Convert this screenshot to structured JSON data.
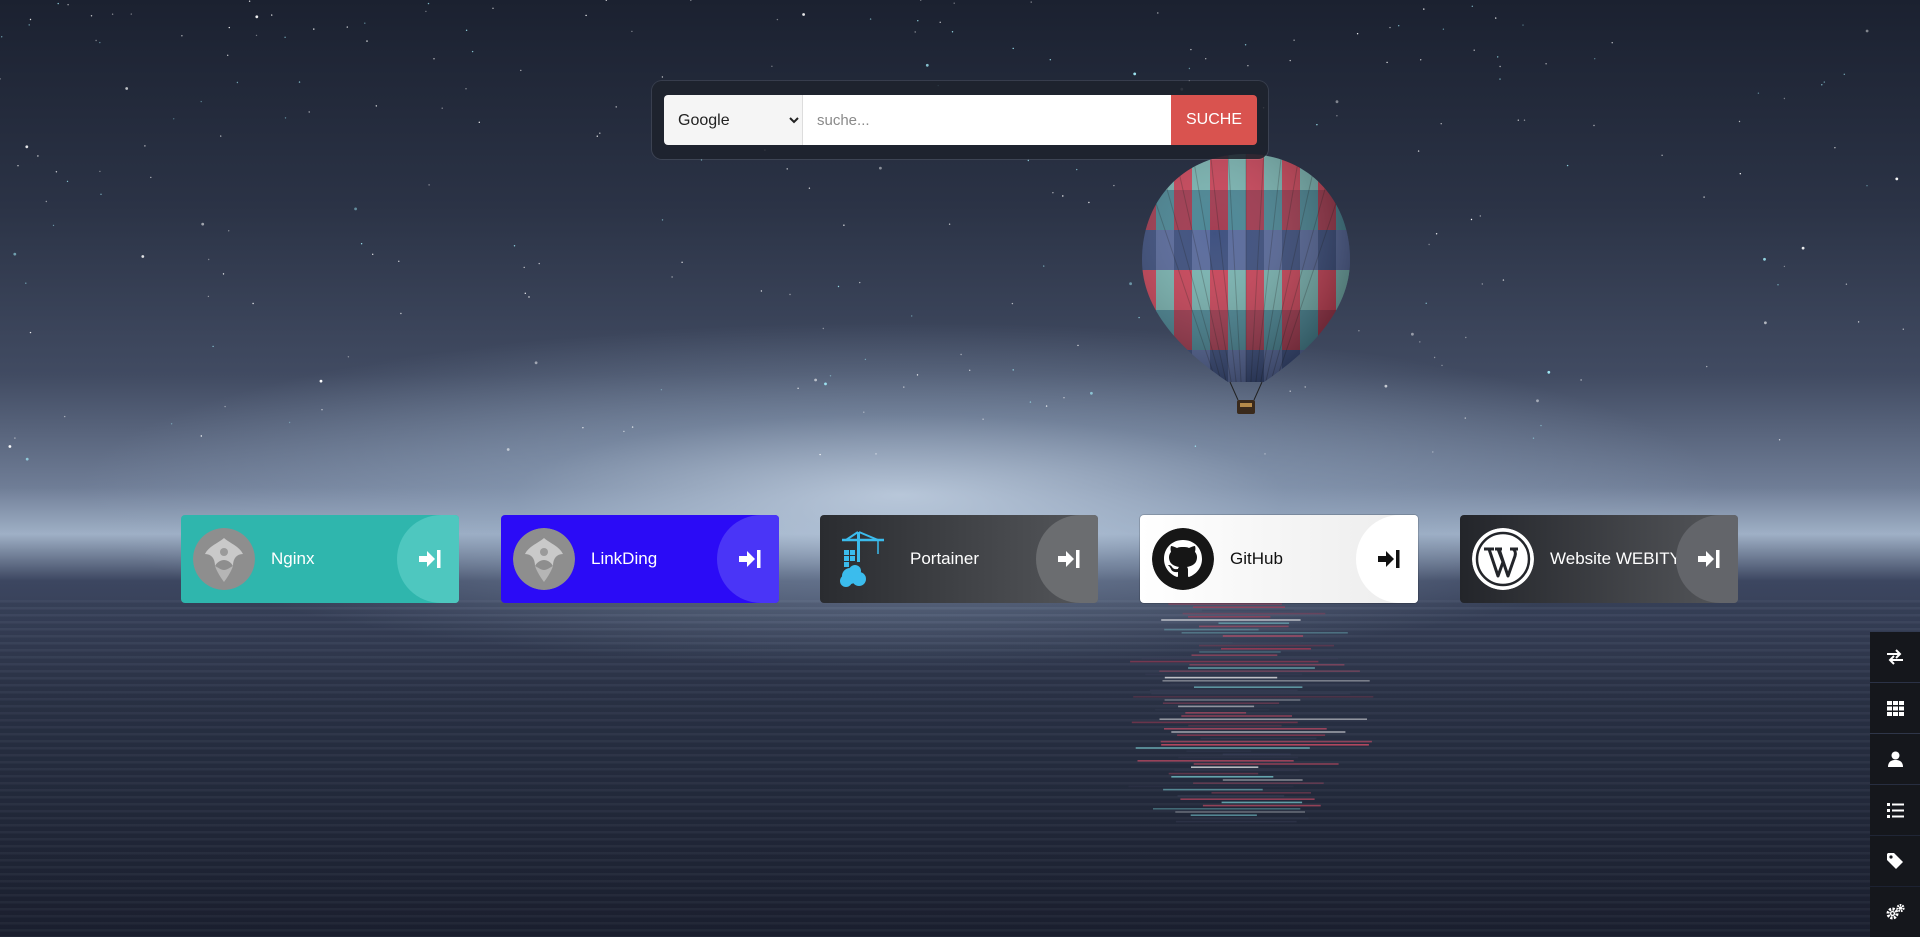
{
  "search": {
    "engine_selected": "Google",
    "engine_options": [
      "Google"
    ],
    "placeholder": "suche...",
    "value": "",
    "button_label": "SUCHE"
  },
  "apps": [
    {
      "name": "Nginx",
      "logo": "app-logo-icon",
      "bg": "#2fb6ad",
      "go_bg": "#4ec7bf",
      "arrow_color": "#ffffff"
    },
    {
      "name": "LinkDing",
      "logo": "app-logo-icon",
      "bg": "#2b0bf6",
      "go_bg": "#4a35f7",
      "arrow_color": "#ffffff"
    },
    {
      "name": "Portainer",
      "logo": "portainer-icon",
      "bg": "#2a2c30",
      "go_bg": "#6b6d70",
      "arrow_color": "#ffffff"
    },
    {
      "name": "GitHub",
      "logo": "github-icon",
      "bg": "#f8f8f8",
      "go_bg": "#ffffff",
      "arrow_color": "#111111"
    },
    {
      "name": "Website WEBITY",
      "logo": "wordpress-icon",
      "bg": "#23252a",
      "go_bg": "#63656a",
      "arrow_color": "#ffffff"
    }
  ],
  "sidenav": [
    {
      "icon": "exchange-icon"
    },
    {
      "icon": "grid-icon"
    },
    {
      "icon": "user-icon"
    },
    {
      "icon": "list-icon"
    },
    {
      "icon": "tag-icon"
    },
    {
      "icon": "settings-icon"
    }
  ]
}
